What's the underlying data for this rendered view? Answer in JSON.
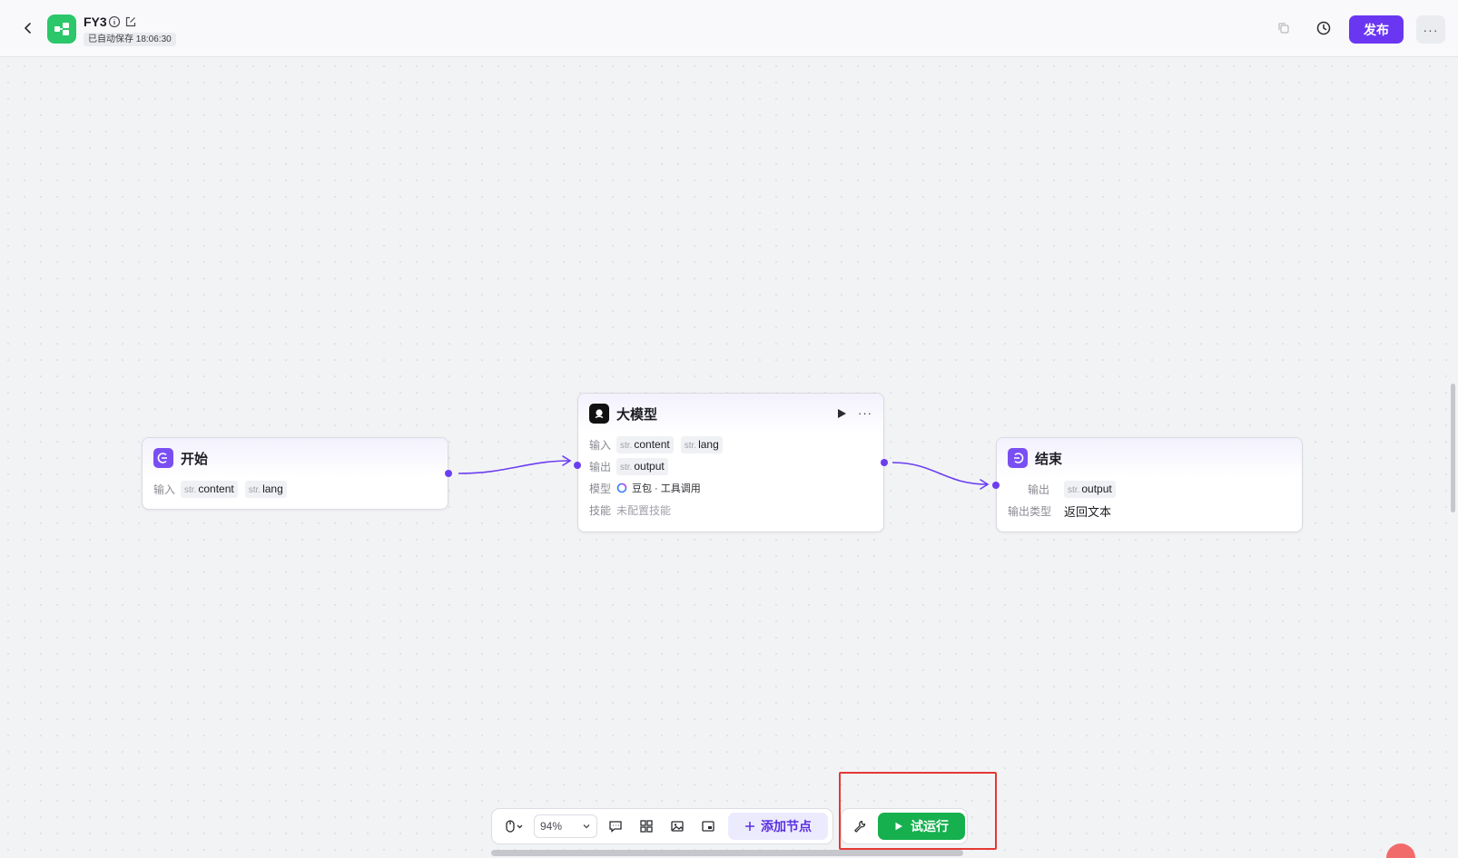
{
  "header": {
    "app_name": "FY3",
    "save_status": "已自动保存 18:06:30",
    "publish_label": "发布",
    "more_label": "···"
  },
  "nodes": {
    "start": {
      "title": "开始",
      "input_label": "输入",
      "inputs": [
        {
          "type": "str.",
          "name": "content"
        },
        {
          "type": "str.",
          "name": "lang"
        }
      ]
    },
    "llm": {
      "title": "大模型",
      "input_label": "输入",
      "inputs": [
        {
          "type": "str.",
          "name": "content"
        },
        {
          "type": "str.",
          "name": "lang"
        }
      ],
      "output_label": "输出",
      "outputs": [
        {
          "type": "str.",
          "name": "output"
        }
      ],
      "model_label": "模型",
      "model_value": "豆包 · 工具调用",
      "skill_label": "技能",
      "skill_value": "未配置技能",
      "more_label": "···"
    },
    "end": {
      "title": "结束",
      "output_label": "输出",
      "outputs": [
        {
          "type": "str.",
          "name": "output"
        }
      ],
      "output_type_label": "输出类型",
      "output_type_value": "返回文本"
    }
  },
  "toolbar": {
    "zoom": "94%",
    "add_node_label": "添加节点",
    "run_label": "试运行"
  },
  "colors": {
    "accent": "#6a36f2",
    "app_icon": "#2bc76a",
    "run": "#16b04e",
    "highlight": "#e53935",
    "edge": "#6a3ef0"
  },
  "icons": [
    "back-arrow-icon",
    "workflow-icon",
    "info-icon",
    "edit-icon",
    "copy-icon",
    "history-icon",
    "start-node-icon",
    "llm-node-icon",
    "end-node-icon",
    "play-icon",
    "mouse-icon",
    "chevron-down-icon",
    "comment-icon",
    "grid-icon",
    "image-icon",
    "minimap-icon",
    "plus-icon",
    "wrench-icon"
  ]
}
